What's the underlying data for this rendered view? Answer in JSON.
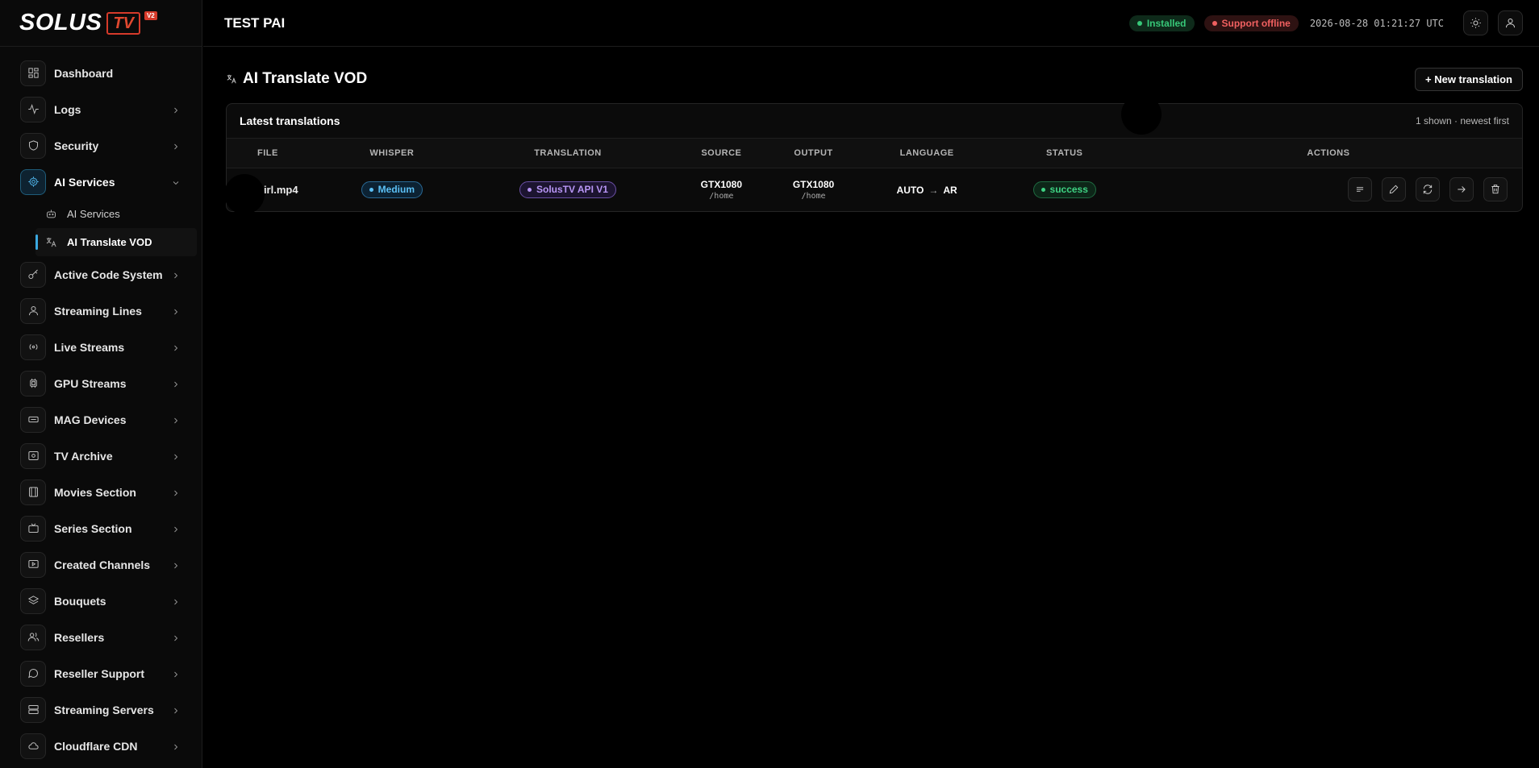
{
  "brand": {
    "word": "SOLUS",
    "tv": "TV",
    "version": "V2"
  },
  "sidebar": {
    "items": [
      {
        "label": "Dashboard",
        "icon": "dashboard-icon",
        "chevron": false
      },
      {
        "label": "Logs",
        "icon": "activity-icon",
        "chevron": true
      },
      {
        "label": "Security",
        "icon": "shield-icon",
        "chevron": true
      },
      {
        "label": "AI Services",
        "icon": "cpu-gear-icon",
        "chevron": true,
        "expanded": true
      },
      {
        "label": "Active Code System",
        "icon": "key-icon",
        "chevron": true
      },
      {
        "label": "Streaming Lines",
        "icon": "user-icon",
        "chevron": true
      },
      {
        "label": "Live Streams",
        "icon": "broadcast-icon",
        "chevron": true
      },
      {
        "label": "GPU Streams",
        "icon": "chip-icon",
        "chevron": true
      },
      {
        "label": "MAG Devices",
        "icon": "device-icon",
        "chevron": true
      },
      {
        "label": "TV Archive",
        "icon": "archive-icon",
        "chevron": true
      },
      {
        "label": "Movies Section",
        "icon": "film-icon",
        "chevron": true
      },
      {
        "label": "Series Section",
        "icon": "tv-icon",
        "chevron": true
      },
      {
        "label": "Created Channels",
        "icon": "play-screen-icon",
        "chevron": true
      },
      {
        "label": "Bouquets",
        "icon": "layers-icon",
        "chevron": true
      },
      {
        "label": "Resellers",
        "icon": "users-icon",
        "chevron": true
      },
      {
        "label": "Reseller Support",
        "icon": "message-icon",
        "chevron": true
      },
      {
        "label": "Streaming Servers",
        "icon": "server-icon",
        "chevron": true
      },
      {
        "label": "Cloudflare CDN",
        "icon": "cloud-icon",
        "chevron": true
      }
    ],
    "subitems": [
      {
        "label": "AI Services",
        "icon": "robot-icon"
      },
      {
        "label": "AI Translate VOD",
        "icon": "translate-icon",
        "active": true
      }
    ]
  },
  "header": {
    "title": "TEST PAI",
    "installed": "Installed",
    "support": "Support offline",
    "clock": "2026-08-28 01:21:27 UTC"
  },
  "page": {
    "title": "AI Translate VOD",
    "new_button": "+ New translation"
  },
  "card": {
    "title": "Latest translations",
    "meta": "1 shown · newest first",
    "columns": [
      "FILE",
      "WHISPER",
      "TRANSLATION",
      "SOURCE",
      "OUTPUT",
      "LANGUAGE",
      "STATUS",
      "ACTIONS"
    ],
    "rows": [
      {
        "file": "girl.mp4",
        "whisper": "Medium",
        "translation": "SolusTV API V1",
        "source_main": "GTX1080",
        "source_sub": "/home",
        "output_main": "GTX1080",
        "output_sub": "/home",
        "lang_from": "AUTO",
        "lang_arrow": "→",
        "lang_to": "AR",
        "status": "success"
      }
    ]
  },
  "colors": {
    "accent": "#3aa8e0",
    "brand": "#d63a2a",
    "success": "#3fd383",
    "danger": "#f06060"
  }
}
